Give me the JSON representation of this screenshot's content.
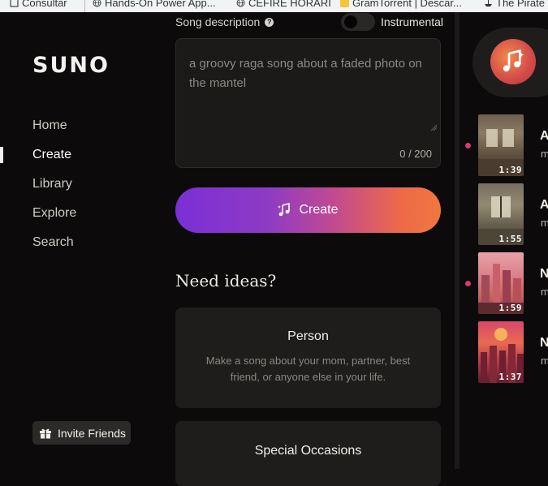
{
  "bookmarks": [
    {
      "label": "Consultar",
      "icon": "page-icon"
    },
    {
      "label": "Hands-On Power App...",
      "icon": "globe-icon"
    },
    {
      "label": "CEFIRE HORARI",
      "icon": "globe-icon"
    },
    {
      "label": "GramTorrent | Descar...",
      "icon": "star-icon"
    },
    {
      "label": "The Pirate",
      "icon": "ship-icon"
    }
  ],
  "sidebar": {
    "logo": "SUNO",
    "nav": [
      "Home",
      "Create",
      "Library",
      "Explore",
      "Search"
    ],
    "active": "Create",
    "invite_label": "Invite Friends"
  },
  "form": {
    "description_label": "Song description",
    "instrumental_label": "Instrumental",
    "instrumental_on": false,
    "description_value": "a groovy raga song about a faded photo on the mantel",
    "counter": "0 / 200",
    "create_label": "Create"
  },
  "ideas": {
    "title": "Need ideas?",
    "cards": [
      {
        "title": "Person",
        "desc": "Make a song about your mom, partner, best friend, or anyone else in your life."
      },
      {
        "title": "Special Occasions",
        "desc": ""
      }
    ]
  },
  "songs": [
    {
      "duration": "1:39",
      "title_initial": "A",
      "sub_initial": "m",
      "new": true
    },
    {
      "duration": "1:55",
      "title_initial": "A",
      "sub_initial": "m",
      "new": false
    },
    {
      "duration": "1:59",
      "title_initial": "N",
      "sub_initial": "m",
      "new": true
    },
    {
      "duration": "1:37",
      "title_initial": "N",
      "sub_initial": "m",
      "new": false
    }
  ],
  "colors": {
    "background": "#0c0a0a",
    "accent_purple": "#7b2fd6",
    "accent_orange": "#f0773f",
    "new_dot": "#d63a6e"
  }
}
